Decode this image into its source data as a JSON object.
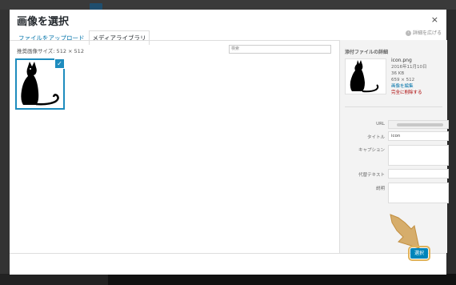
{
  "modal": {
    "title": "画像を選択",
    "close_icon": "×",
    "tabs": [
      "ファイルをアップロード",
      "メディアライブラリ"
    ],
    "details_toggle": "詳細を広げる",
    "filter_label": "推奨画像サイズ: 512 × 512",
    "search_placeholder": "検索"
  },
  "sidebar": {
    "heading": "添付ファイルの詳細",
    "file_name": "icon.png",
    "date": "2016年11月10日",
    "file_size": "36 KB",
    "dimensions": "659 × 512",
    "edit_link": "画像を編集",
    "delete_link": "完全に削除する",
    "fields": {
      "url_label": "URL",
      "title_label": "タイトル",
      "title_value": "icon",
      "caption_label": "キャプション",
      "alt_label": "代替テキスト",
      "description_label": "説明"
    }
  },
  "footer": {
    "select_label": "選択"
  },
  "colors": {
    "accent": "#0085ba",
    "link": "#0073aa",
    "delete": "#a00",
    "highlight": "#e0b35a"
  }
}
